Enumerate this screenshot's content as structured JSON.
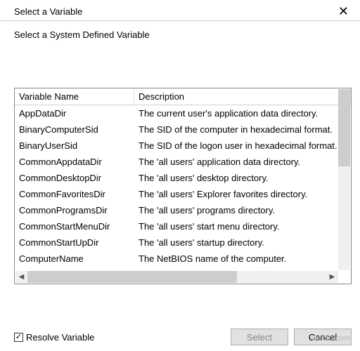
{
  "window": {
    "title": "Select a Variable",
    "close_glyph": "✕"
  },
  "subtitle": "Select a System Defined Variable",
  "columns": {
    "name": "Variable Name",
    "desc": "Description"
  },
  "rows": [
    {
      "name": "AppDataDir",
      "desc": "The current user's application data directory."
    },
    {
      "name": "BinaryComputerSid",
      "desc": "The SID of the computer in hexadecimal format."
    },
    {
      "name": "BinaryUserSid",
      "desc": "The SID of the logon user in hexadecimal format."
    },
    {
      "name": "CommonAppdataDir",
      "desc": "The 'all users' application data directory."
    },
    {
      "name": "CommonDesktopDir",
      "desc": "The 'all users' desktop directory."
    },
    {
      "name": "CommonFavoritesDir",
      "desc": "The 'all users' Explorer favorites directory."
    },
    {
      "name": "CommonProgramsDir",
      "desc": "The 'all users' programs directory."
    },
    {
      "name": "CommonStartMenuDir",
      "desc": "The 'all users' start menu directory."
    },
    {
      "name": "CommonStartUpDir",
      "desc": "The 'all users' startup directory."
    },
    {
      "name": "ComputerName",
      "desc": "The NetBIOS name of the computer."
    }
  ],
  "resolve": {
    "label": "Resolve Variable",
    "checked": true,
    "check_glyph": "✓"
  },
  "buttons": {
    "select": "Select",
    "cancel": "Cancel"
  },
  "watermark": "wsxdn.com"
}
